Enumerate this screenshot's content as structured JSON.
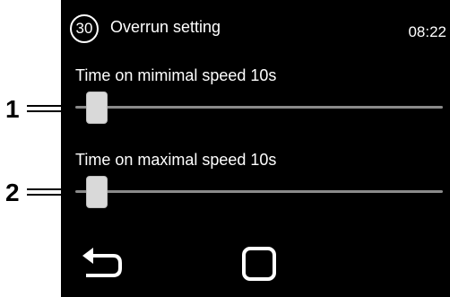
{
  "callouts": [
    {
      "label": "1"
    },
    {
      "label": "2"
    }
  ],
  "header": {
    "badge": "30",
    "title": "Overrun setting",
    "clock": "08:22"
  },
  "sliders": [
    {
      "label": "Time on mimimal speed 10s",
      "value_fraction": 0.03
    },
    {
      "label": "Time on maximal speed 10s",
      "value_fraction": 0.03
    }
  ],
  "nav": {
    "back_icon": "back-arrow-icon",
    "home_icon": "square-home-icon"
  },
  "colors": {
    "screen_bg": "#000000",
    "text": "#ffffff",
    "track": "#8a8a8a",
    "thumb": "#d9d9d9"
  }
}
